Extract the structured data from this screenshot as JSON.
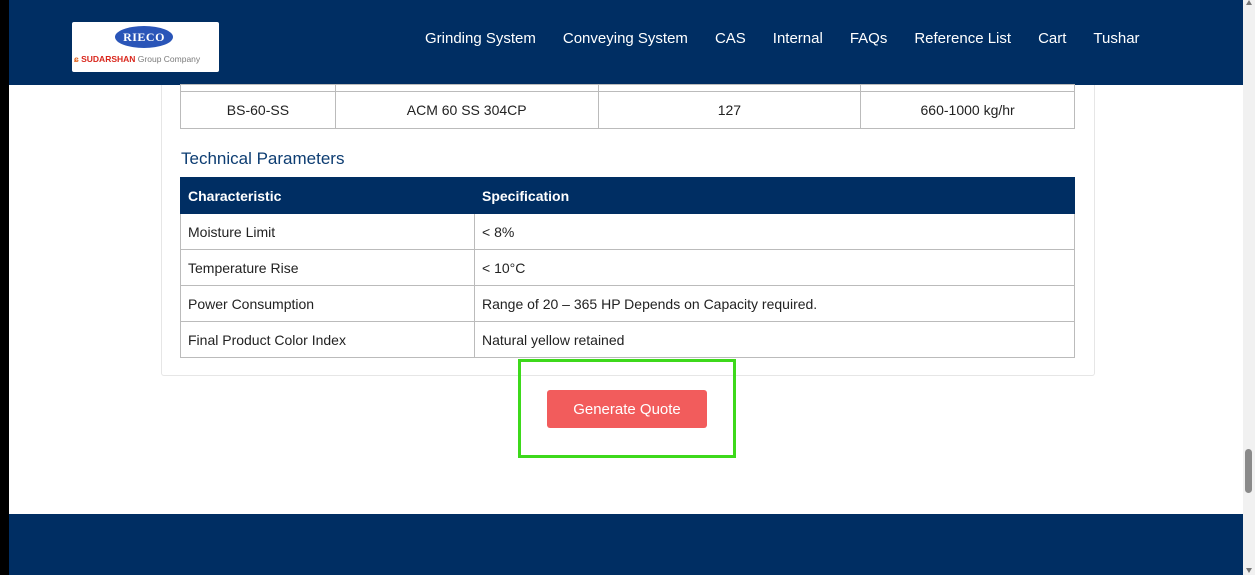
{
  "brand": {
    "logo_text": "RIECO",
    "group_brand": "SUDARSHAN",
    "group_suffix": "Group Company",
    "colors": {
      "navy": "#002e63",
      "accent_button": "#f25c5c",
      "highlight": "#3dd91b"
    }
  },
  "nav": {
    "items": [
      {
        "label": "Grinding System"
      },
      {
        "label": "Conveying System"
      },
      {
        "label": "CAS"
      },
      {
        "label": "Internal"
      },
      {
        "label": "FAQs"
      },
      {
        "label": "Reference List"
      },
      {
        "label": "Cart"
      },
      {
        "label": "Tushar"
      }
    ]
  },
  "models_table": {
    "rows": [
      {
        "model": "BS-60-SS",
        "machine": "ACM 60 SS 304CP",
        "value": "127",
        "capacity": "660-1000 kg/hr"
      }
    ]
  },
  "technical": {
    "title": "Technical Parameters",
    "headers": [
      "Characteristic",
      "Specification"
    ],
    "rows": [
      {
        "characteristic": "Moisture Limit",
        "specification": "< 8%"
      },
      {
        "characteristic": "Temperature Rise",
        "specification": "< 10°C"
      },
      {
        "characteristic": "Power Consumption",
        "specification": "Range of 20 – 365 HP Depends on Capacity required."
      },
      {
        "characteristic": "Final Product Color Index",
        "specification": "Natural yellow retained"
      }
    ]
  },
  "actions": {
    "generate_quote_label": "Generate Quote"
  }
}
